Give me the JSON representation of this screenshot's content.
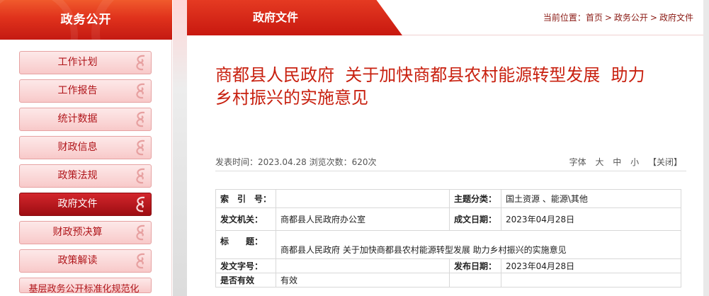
{
  "sidebar": {
    "title": "政务公开",
    "items": [
      {
        "label": "工作计划",
        "active": false
      },
      {
        "label": "工作报告",
        "active": false
      },
      {
        "label": "统计数据",
        "active": false
      },
      {
        "label": "财政信息",
        "active": false
      },
      {
        "label": "政策法规",
        "active": false
      },
      {
        "label": "政府文件",
        "active": true
      },
      {
        "label": "财政预决算",
        "active": false
      },
      {
        "label": "政策解读",
        "active": false
      },
      {
        "label": "基层政务公开标准化规范化",
        "active": false
      }
    ]
  },
  "main": {
    "tab_title": "政府文件",
    "breadcrumb": {
      "prefix": "当前位置：",
      "items": [
        "首页",
        "政务公开",
        "政府文件"
      ],
      "separator": ">"
    },
    "doc_title_line1": "商都县人民政府  关于加快商都县农村能源转型发展  助力",
    "doc_title_line2": "乡村振兴的实施意见",
    "meta": {
      "publish_time_label": "发表时间：",
      "publish_time": "2023.04.28",
      "views_label": "浏览次数：",
      "views": "620次",
      "font_label": "字体",
      "font_large": "大",
      "font_medium": "中",
      "font_small": "小",
      "close": "【关闭】"
    },
    "info_table": {
      "index_label": "索　引　号：",
      "index_value": "",
      "category_label": "主题分类：",
      "category_value": "国土资源 、能源\\其他",
      "issuer_label": "发文机关：",
      "issuer_value": "商都县人民政府办公室",
      "created_label": "成文日期：",
      "created_value": "2023年04月28日",
      "title_label": "标　　题：",
      "title_value": "商都县人民政府 关于加快商都县农村能源转型发展 助力乡村振兴的实施意见",
      "docno_label": "发文字号：",
      "docno_value": "",
      "published_label": "发布日期：",
      "published_value": "2023年04月28日",
      "valid_label": "是否有效",
      "valid_value": "有效"
    }
  },
  "colors": {
    "accent_red": "#c8200f",
    "active_menu": "#b01015",
    "menu_bg": "#f8c9c9"
  }
}
